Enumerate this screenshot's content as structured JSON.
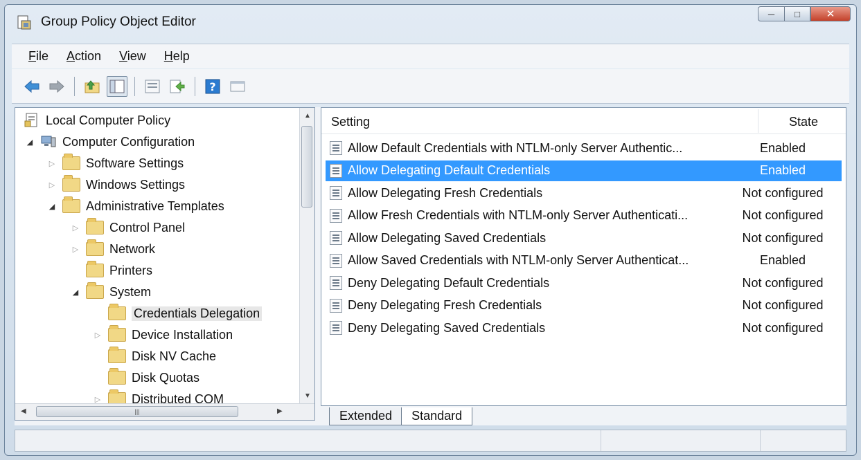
{
  "window": {
    "title": "Group Policy Object Editor"
  },
  "menu": [
    {
      "id": "file",
      "accel": "F",
      "rest": "ile"
    },
    {
      "id": "action",
      "accel": "A",
      "rest": "ction"
    },
    {
      "id": "view",
      "accel": "V",
      "rest": "iew"
    },
    {
      "id": "help",
      "accel": "H",
      "rest": "elp"
    }
  ],
  "toolbar": {
    "icons": [
      "back-arrow-icon",
      "forward-arrow-icon",
      "up-folder-icon",
      "show-hide-tree-icon",
      "properties-icon",
      "export-list-icon",
      "help-icon",
      "console-view-icon"
    ]
  },
  "tree": {
    "items": [
      {
        "label": "Local Computer Policy",
        "level": 0,
        "icon": "policy-document-icon"
      },
      {
        "label": "Computer Configuration",
        "level": 1,
        "icon": "computer-icon",
        "expander": "open"
      },
      {
        "label": "Software Settings",
        "level": 2,
        "icon": "folder-icon",
        "expander": "closed"
      },
      {
        "label": "Windows Settings",
        "level": 2,
        "icon": "folder-icon",
        "expander": "closed"
      },
      {
        "label": "Administrative Templates",
        "level": 2,
        "icon": "folder-icon",
        "expander": "open"
      },
      {
        "label": "Control Panel",
        "level": 3,
        "icon": "folder-icon",
        "expander": "closed"
      },
      {
        "label": "Network",
        "level": 3,
        "icon": "folder-icon",
        "expander": "closed"
      },
      {
        "label": "Printers",
        "level": 3,
        "icon": "folder-icon",
        "expander": "none"
      },
      {
        "label": "System",
        "level": 3,
        "icon": "folder-icon",
        "expander": "open"
      },
      {
        "label": "Credentials Delegation",
        "level": 4,
        "icon": "folder-icon",
        "expander": "none",
        "selected": true
      },
      {
        "label": "Device Installation",
        "level": 4,
        "icon": "folder-icon",
        "expander": "closed"
      },
      {
        "label": "Disk NV Cache",
        "level": 4,
        "icon": "folder-icon",
        "expander": "none"
      },
      {
        "label": "Disk Quotas",
        "level": 4,
        "icon": "folder-icon",
        "expander": "none"
      },
      {
        "label": "Distributed COM",
        "level": 4,
        "icon": "folder-icon",
        "expander": "closed"
      }
    ]
  },
  "list": {
    "columns": {
      "setting": "Setting",
      "state": "State"
    },
    "rows": [
      {
        "setting": "Allow Default Credentials with NTLM-only Server Authentic...",
        "state": "Enabled"
      },
      {
        "setting": "Allow Delegating Default Credentials",
        "state": "Enabled",
        "selected": true
      },
      {
        "setting": "Allow Delegating Fresh Credentials",
        "state": "Not configured"
      },
      {
        "setting": "Allow Fresh Credentials with NTLM-only Server Authenticati...",
        "state": "Not configured"
      },
      {
        "setting": "Allow Delegating Saved Credentials",
        "state": "Not configured"
      },
      {
        "setting": "Allow Saved Credentials with NTLM-only Server Authenticat...",
        "state": "Enabled"
      },
      {
        "setting": "Deny Delegating Default Credentials",
        "state": "Not configured"
      },
      {
        "setting": "Deny Delegating Fresh Credentials",
        "state": "Not configured"
      },
      {
        "setting": "Deny Delegating Saved Credentials",
        "state": "Not configured"
      }
    ]
  },
  "tabs": [
    {
      "label": "Extended",
      "active": false
    },
    {
      "label": "Standard",
      "active": true
    }
  ],
  "colors": {
    "selection": "#3399ff",
    "accent_icon": "#2b7bd0"
  }
}
